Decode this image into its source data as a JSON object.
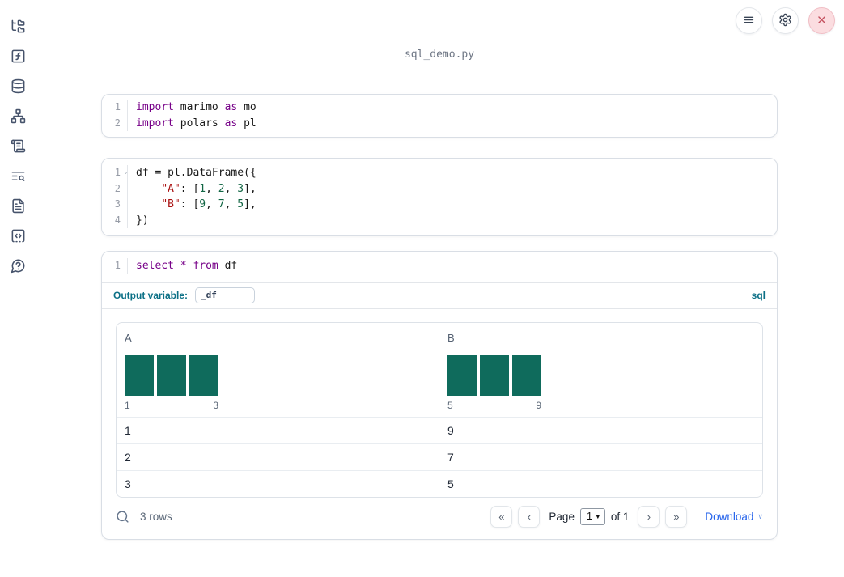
{
  "app": {
    "title": "sql_demo.py"
  },
  "sidebar": {
    "items": [
      {
        "icon": "file-tree-icon"
      },
      {
        "icon": "function-square-icon"
      },
      {
        "icon": "database-icon"
      },
      {
        "icon": "network-icon"
      },
      {
        "icon": "scroll-text-icon"
      },
      {
        "icon": "text-search-icon"
      },
      {
        "icon": "file-text-icon"
      },
      {
        "icon": "snippets-code-icon"
      },
      {
        "icon": "help-bubble-icon"
      }
    ]
  },
  "topbar": {
    "buttons": [
      {
        "icon": "menu-icon"
      },
      {
        "icon": "gear-icon"
      },
      {
        "icon": "close-icon"
      }
    ]
  },
  "cells": [
    {
      "lines": [
        {
          "n": "1",
          "tokens": [
            {
              "t": "import",
              "c": "kw"
            },
            {
              "t": " marimo ",
              "c": "pl"
            },
            {
              "t": "as",
              "c": "kw"
            },
            {
              "t": " mo",
              "c": "pl"
            }
          ]
        },
        {
          "n": "2",
          "tokens": [
            {
              "t": "import",
              "c": "kw"
            },
            {
              "t": " polars ",
              "c": "pl"
            },
            {
              "t": "as",
              "c": "kw"
            },
            {
              "t": " pl",
              "c": "pl"
            }
          ]
        }
      ]
    },
    {
      "lines": [
        {
          "n": "1",
          "tokens": [
            {
              "t": "df = pl.DataFrame({",
              "c": "pl"
            }
          ]
        },
        {
          "n": "2",
          "tokens": [
            {
              "t": "    ",
              "c": "pl"
            },
            {
              "t": "\"A\"",
              "c": "str"
            },
            {
              "t": ": [",
              "c": "pl"
            },
            {
              "t": "1",
              "c": "num"
            },
            {
              "t": ", ",
              "c": "pl"
            },
            {
              "t": "2",
              "c": "num"
            },
            {
              "t": ", ",
              "c": "pl"
            },
            {
              "t": "3",
              "c": "num"
            },
            {
              "t": "],",
              "c": "pl"
            }
          ]
        },
        {
          "n": "3",
          "tokens": [
            {
              "t": "    ",
              "c": "pl"
            },
            {
              "t": "\"B\"",
              "c": "str"
            },
            {
              "t": ": [",
              "c": "pl"
            },
            {
              "t": "9",
              "c": "num"
            },
            {
              "t": ", ",
              "c": "pl"
            },
            {
              "t": "7",
              "c": "num"
            },
            {
              "t": ", ",
              "c": "pl"
            },
            {
              "t": "5",
              "c": "num"
            },
            {
              "t": "],",
              "c": "pl"
            }
          ]
        },
        {
          "n": "4",
          "tokens": [
            {
              "t": "})",
              "c": "pl"
            }
          ]
        }
      ]
    },
    {
      "lines": [
        {
          "n": "1",
          "tokens": [
            {
              "t": "select",
              "c": "kw"
            },
            {
              "t": " ",
              "c": "pl"
            },
            {
              "t": "*",
              "c": "kw"
            },
            {
              "t": " ",
              "c": "pl"
            },
            {
              "t": "from",
              "c": "kw"
            },
            {
              "t": " df",
              "c": "pl"
            }
          ]
        }
      ],
      "output_variable_label": "Output variable:",
      "output_variable_value": "_df",
      "language_badge": "sql"
    }
  ],
  "table": {
    "columns": [
      {
        "label": "A",
        "hist": {
          "type": "bar",
          "bars": [
            1,
            1,
            1
          ],
          "min": "1",
          "max": "3"
        }
      },
      {
        "label": "B",
        "hist": {
          "type": "bar",
          "bars": [
            1,
            1,
            1
          ],
          "min": "5",
          "max": "9"
        }
      }
    ],
    "rows": [
      {
        "a": "1",
        "b": "9"
      },
      {
        "a": "2",
        "b": "7"
      },
      {
        "a": "3",
        "b": "5"
      }
    ],
    "footer": {
      "row_count": "3 rows",
      "pager_icons": {
        "first": "«",
        "prev": "‹",
        "next": "›",
        "last": "»"
      },
      "page_label": "Page",
      "page_value": "1",
      "page_total": "of 1",
      "download_label": "Download"
    }
  },
  "colors": {
    "accent_teal_blue": "#0c7086",
    "link_blue": "#2563eb",
    "histogram_green": "#0f6b5c",
    "close_red": "#c4515f",
    "keyword_purple": "#770088",
    "string_red": "#aa1111",
    "number_green": "#116644"
  }
}
